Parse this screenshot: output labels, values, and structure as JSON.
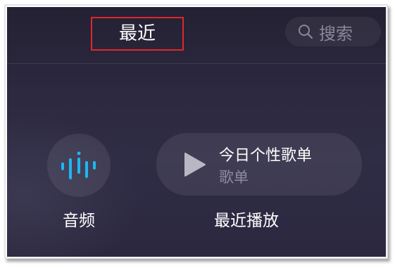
{
  "header": {
    "title": "最近",
    "search_label": "搜索",
    "search_icon": "search-icon",
    "title_highlight_color": "#e0262a"
  },
  "shortcuts": {
    "audio": {
      "label": "音频",
      "icon": "audio-waveform-icon",
      "icon_color": "#1fb6f2"
    },
    "playlist": {
      "name": "今日个性歌单",
      "type": "歌单",
      "icon": "play-icon",
      "section_label": "最近播放"
    }
  },
  "colors": {
    "background": "#2c2940",
    "text_primary": "#ffffff",
    "text_secondary": "#8e8b9e"
  }
}
